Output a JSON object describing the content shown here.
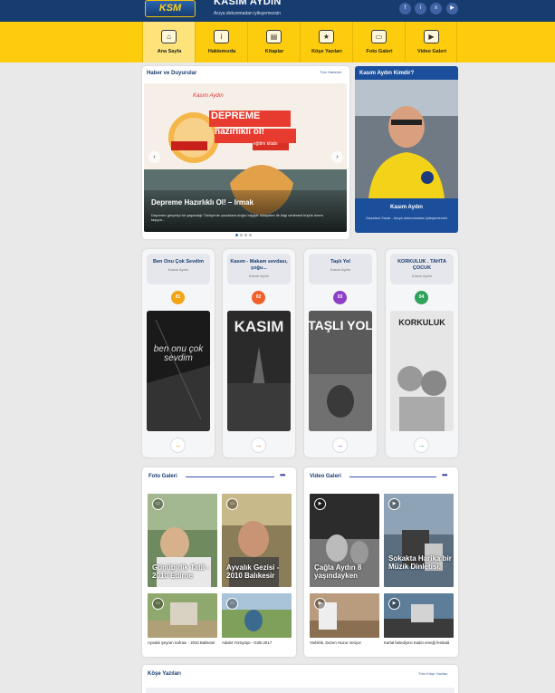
{
  "header": {
    "logo_text": "KSM",
    "title": "KASIM AYDIN",
    "subtitle": "Acıya dokunmadan iyileşemezsin",
    "social_icons": [
      "facebook-icon",
      "instagram-icon",
      "x-icon",
      "youtube-icon"
    ],
    "social_glyphs": [
      "f",
      "i",
      "x",
      "▶"
    ]
  },
  "nav": {
    "items": [
      {
        "label": "Ana Sayfa",
        "icon": "home-icon",
        "glyph": "⌂"
      },
      {
        "label": "Hakkımızda",
        "icon": "info-icon",
        "glyph": "i"
      },
      {
        "label": "Kitaplar",
        "icon": "book-icon",
        "glyph": "▤"
      },
      {
        "label": "Köşe Yazıları",
        "icon": "star-icon",
        "glyph": "★"
      },
      {
        "label": "Foto Galeri",
        "icon": "camera-icon",
        "glyph": "▭"
      },
      {
        "label": "Video Galeri",
        "icon": "play-icon",
        "glyph": "▶"
      }
    ]
  },
  "news": {
    "title": "Haber ve Duyurular",
    "link": "Tüm Haberler",
    "slide_cover_author": "Kasım Aydın",
    "slide_cover_line1": "DEPREME",
    "slide_cover_line2": "hazırlıklı ol!",
    "slide_cover_line3": "eğitim kitabı",
    "slide_title": "Depreme Hazırlıklı Ol! – Irmak",
    "slide_text": "Depreme gerçekçi bir yaşandığı Türkiye'de çocuklara doğru bilgiyle hikâyeleri ile bilgi verilmesi büyük önem taşıyor...",
    "prev": "‹",
    "next": "›"
  },
  "profile": {
    "title": "Kasım Aydın Kimdir?",
    "name": "Kasım Aydın",
    "desc": "Gazeteci-Yazar - Acıya dokunmadan iyileşemezsin"
  },
  "books": [
    {
      "title": "Ben Onu Çok Sevdim",
      "author": "Kasım Aydın",
      "num": "01",
      "cover_text": "ben onu çok sevdim",
      "color": "#f2a516",
      "arrow": "→"
    },
    {
      "title": "Kasım - Makam sevdası, çoğu...",
      "author": "Kasım Aydın",
      "num": "02",
      "cover_text": "KASIM",
      "color": "#f0602a",
      "arrow": "→"
    },
    {
      "title": "Taşlı Yol",
      "author": "Kasım Aydın",
      "num": "03",
      "cover_text": "TAŞLI YOL",
      "color": "#8e3fc8",
      "arrow": "→"
    },
    {
      "title": "KORKULUK . TAHTA ÇOCUK",
      "author": "Kasım Aydın",
      "num": "04",
      "cover_text": "KORKULUK",
      "color": "#2fa35a",
      "arrow": "→"
    }
  ],
  "photo_gallery": {
    "title": "Foto Galeri",
    "more": "•••",
    "large": [
      {
        "caption": "Günübirlik Tatil - 2010 Edirne"
      },
      {
        "caption": "Ayvalık Gezisi - 2010 Balıkesir"
      }
    ],
    "small": [
      {
        "caption": "Ayvalık Şeyran Sofrası - 2010 Balıkesir"
      },
      {
        "caption": "Adalet Yürüyüşü - Gölü 2017"
      }
    ]
  },
  "video_gallery": {
    "title": "Video Galeri",
    "more": "•••",
    "large": [
      {
        "caption": "Çağla Aydın 8 yaşındayken"
      },
      {
        "caption": "Sokakta Harika bir Müzik Dinletisi."
      }
    ],
    "small": [
      {
        "caption": "Yarlıklık, Dezen Huzur Veriyor"
      },
      {
        "caption": "Kartal belediyesi Kadın emeği festivali"
      }
    ]
  },
  "columns": {
    "title": "Köşe Yazıları",
    "link": "Tüm Köşe Yazıları"
  },
  "colors": {
    "header_blue": "#173d70",
    "nav_yellow": "#fccc0d",
    "accent_blue": "#1b4f9c"
  }
}
